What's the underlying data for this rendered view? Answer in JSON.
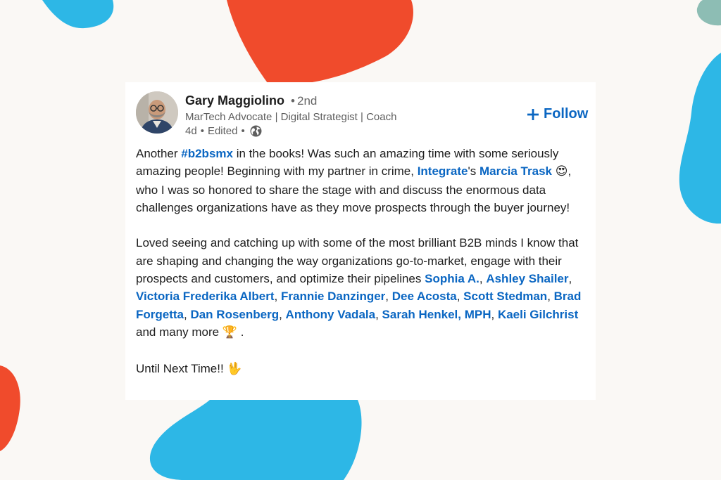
{
  "post": {
    "author": {
      "name": "Gary Maggiolino",
      "degree_separator": "•",
      "degree": "2nd",
      "headline": "MarTech Advocate | Digital Strategist | Coach",
      "time": "4d",
      "meta_separator": "•",
      "edited": "Edited",
      "visibility_icon": "globe-icon"
    },
    "follow_label": "Follow",
    "follow_icon": "plus-icon",
    "paragraph_1": {
      "t1": "Another ",
      "hashtag": "#b2bsmx",
      "t2": " in the books! Was such an amazing time with some seriously amazing people! Beginning with my partner in crime, ",
      "company": "Integrate",
      "t3": "'s ",
      "mention": "Marcia Trask",
      "emoji": "😍",
      "t4": ", who I was so honored to share the stage with and discuss the enormous data challenges organizations have as they move prospects through the buyer journey!"
    },
    "paragraph_2": {
      "intro": "Loved seeing and catching up with some of the most brilliant B2B minds I know that are shaping and changing the way organizations go-to-market, engage with their prospects and customers, and optimize their pipelines ",
      "mentions": [
        "Sophia A.",
        "Ashley Shailer",
        "Victoria Frederika Albert",
        "Frannie Danzinger",
        "Dee Acosta",
        "Scott Stedman",
        "Brad Forgetta",
        "Dan Rosenberg",
        "Anthony Vadala",
        "Sarah Henkel, MPH",
        "Kaeli Gilchrist"
      ],
      "separator": ", ",
      "outro": " and many more ",
      "emoji": "🏆",
      "end": " ."
    },
    "paragraph_3": {
      "text": "Until Next Time!! ",
      "emoji": "🖖"
    }
  },
  "colors": {
    "background": "#faf8f5",
    "card": "#ffffff",
    "link": "#0a66c2",
    "blob_blue": "#2db7e6",
    "blob_red": "#f04b2c",
    "blob_teal": "#8dbdb4"
  }
}
